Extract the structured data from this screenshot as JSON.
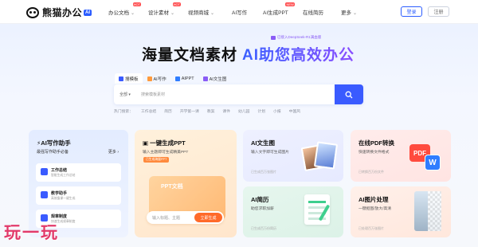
{
  "header": {
    "logo_text": "熊猫办公",
    "logo_badge": "AI",
    "nav": [
      {
        "label": "办公文档",
        "has_dropdown": true,
        "badge": "HOT"
      },
      {
        "label": "设计素材",
        "has_dropdown": true,
        "badge": "HOT"
      },
      {
        "label": "视频商城",
        "has_dropdown": true,
        "badge": ""
      },
      {
        "label": "AI写作",
        "has_dropdown": false,
        "badge": ""
      },
      {
        "label": "AI生成PPT",
        "has_dropdown": false,
        "badge": "NEW"
      },
      {
        "label": "在线简历",
        "has_dropdown": false,
        "badge": ""
      },
      {
        "label": "更多",
        "has_dropdown": true,
        "badge": ""
      }
    ],
    "login_label": "登录",
    "register_label": "注册"
  },
  "hero": {
    "promo": "已接入DeepSeek-R1满血版",
    "headline_main": "海量文档素材",
    "headline_ai": "AI助您高效办公"
  },
  "search": {
    "tabs": [
      "搜模板",
      "AI写作",
      "AIPPT",
      "AI文生图"
    ],
    "active_tab": 0,
    "scope": "全部",
    "placeholder": "搜索模板素材",
    "hot_label": "热门搜索：",
    "hot_words": [
      "工作总结",
      "简历",
      "开学第一课",
      "教案",
      "课件",
      "幼儿园",
      "计划",
      "小报",
      "中国风"
    ]
  },
  "cards": {
    "write": {
      "title": "AI写作助手",
      "subtitle": "最强写作助手必备",
      "more": "更多",
      "items": [
        {
          "title": "工作总结",
          "desc": "智能生成工作总结"
        },
        {
          "title": "教学助手",
          "desc": "高效备课一键生成"
        },
        {
          "title": "规章制度",
          "desc": "快速生成规章制度"
        }
      ]
    },
    "ppt": {
      "title": "一键生成PPT",
      "subtitle": "输入主题即可生成精美PPT",
      "tag": "已生成海量PPT",
      "illus_text": "PPT文档",
      "input_placeholder": "输入标题、主题",
      "button": "立即生成"
    },
    "img": {
      "title": "AI文生图",
      "subtitle": "输入文字即可生成图片",
      "meta": "已生成百万张图片"
    },
    "pdf": {
      "title": "在线PDF转换",
      "subtitle": "快速转换文件格式",
      "meta": "已转换百万份文件",
      "pdf_icon": "PDF",
      "word_icon": "W"
    },
    "resume": {
      "title": "AI简历",
      "subtitle": "助您求职加薪",
      "meta": "已生成百万份简历"
    },
    "imgproc": {
      "title": "AI图片处理",
      "subtitle": "一键抠图/放大/高清",
      "meta": "已处理百万张图片"
    }
  },
  "watermark": "玩一玩"
}
